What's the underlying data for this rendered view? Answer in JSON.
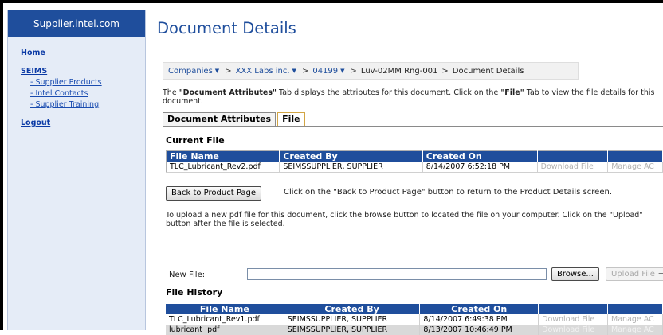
{
  "sidebar": {
    "brand": "Supplier.intel.com",
    "home": "Home",
    "seims": "SEIMS",
    "sub_items": [
      "- Supplier Products",
      "- Intel Contacts",
      "- Supplier Training"
    ],
    "logout": "Logout"
  },
  "header": {
    "title": "Document Details"
  },
  "breadcrumb": {
    "items": [
      "Companies",
      "XXX Labs inc.",
      "04199",
      "Luv-02MM Rng-001",
      "Document Details"
    ],
    "separator": ">",
    "caret": "▼"
  },
  "intro": {
    "part1": "The ",
    "bold1": "\"Document Attributes\"",
    "part2": " Tab displays the attributes for this document. Click on the ",
    "bold2": "\"File\"",
    "part3": " Tab to view the file details for this document."
  },
  "tabs": [
    {
      "label": "Document Attributes",
      "active": false
    },
    {
      "label": "File",
      "active": true
    }
  ],
  "current_file": {
    "heading": "Current File",
    "columns": [
      "File Name",
      "Created By",
      "Created On",
      "",
      ""
    ],
    "row": [
      "TLC_Lubricant_Rev2.pdf",
      "SEIMSSUPPLIER, SUPPLIER",
      "8/14/2007 6:52:18 PM",
      "Download File",
      "Manage AC"
    ]
  },
  "back_button": {
    "label": "Back to Product Page",
    "note": "Click on the \"Back to Product Page\" button to return to the Product Details screen."
  },
  "upload": {
    "note": "To upload a new pdf file for this document, click the browse button to located the file on your computer. Click on the \"Upload\" button after the file is selected.",
    "label": "New File:",
    "value": "",
    "browse_label": "Browse...",
    "upload_label": "Upload File"
  },
  "file_history": {
    "heading": "File History",
    "columns": [
      "File Name",
      "Created By",
      "Created On",
      "",
      ""
    ],
    "rows": [
      [
        "TLC_Lubricant_Rev1.pdf",
        "SEIMSSUPPLIER, SUPPLIER",
        "8/14/2007 6:49:38 PM",
        "Download File",
        "Manage AC"
      ],
      [
        "lubricant .pdf",
        "SEIMSSUPPLIER, SUPPLIER",
        "8/13/2007 10:46:49 PM",
        "Download File",
        "Manage AC"
      ]
    ]
  },
  "colors": {
    "brand_blue": "#1f4e9c",
    "sidebar_bg": "#e5ecf7",
    "tab_active_border": "#d2a544"
  }
}
